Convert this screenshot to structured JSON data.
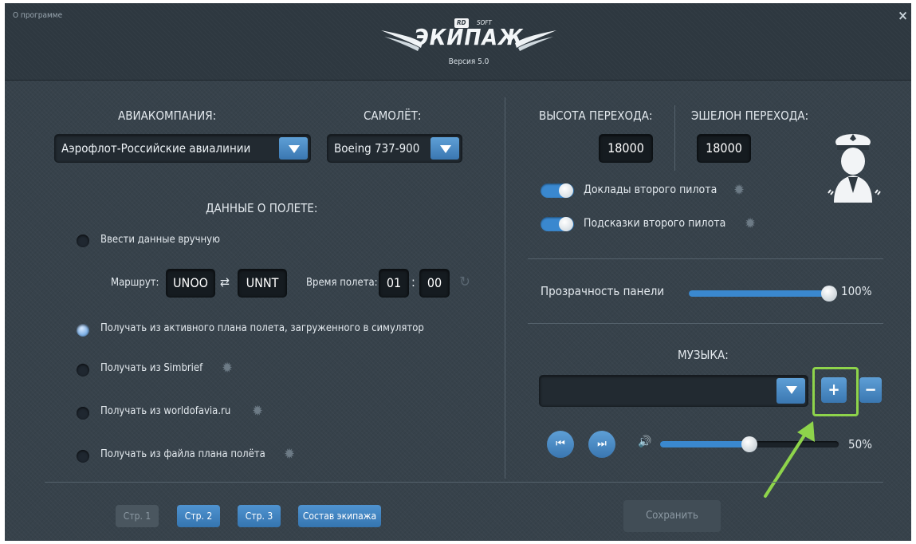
{
  "header": {
    "about_label": "О программе",
    "close_label": "×",
    "logo_badge": "RD",
    "logo_soft": "SOFT",
    "logo_title": "ЭКИПАЖ",
    "version": "Версия 5.0"
  },
  "left": {
    "airline_label": "АВИАКОМПАНИЯ:",
    "airline_value": "Аэрофлот-Российские авиалинии",
    "aircraft_label": "САМОЛЁТ:",
    "aircraft_value": "Boeing 737-900",
    "flight_data_label": "ДАННЫЕ О ПОЛЕТЕ:",
    "manual_option": "Ввести данные вручную",
    "route_label": "Маршрут:",
    "route_from": "UNOO",
    "swap_icon": "⇄",
    "route_to": "UNNT",
    "flight_time_label": "Время полета:",
    "hours": "01",
    "time_sep": ":",
    "minutes": "00",
    "options": [
      {
        "label": "Получать из активного плана полета, загруженного в симулятор",
        "selected": true
      },
      {
        "label": "Получать из Simbrief",
        "selected": false
      },
      {
        "label": "Получать из worldofavia.ru",
        "selected": false
      },
      {
        "label": "Получать из файла плана полёта",
        "selected": false
      }
    ]
  },
  "right": {
    "transition_alt_label": "ВЫСОТА ПЕРЕХОДА:",
    "transition_alt_value": "18000",
    "transition_level_label": "ЭШЕЛОН ПЕРЕХОДА:",
    "transition_level_value": "18000",
    "copilot_reports": {
      "label": "Доклады второго пилота",
      "on": true
    },
    "copilot_hints": {
      "label": "Подсказки второго пилота",
      "on": true
    },
    "panel_opacity_label": "Прозрачность панели",
    "panel_opacity_value": "100%",
    "panel_opacity": 1.0,
    "music_label": "МУЗЫКА:",
    "music_track": "",
    "add_label": "+",
    "remove_label": "−",
    "prev_label": "⏮",
    "next_label": "⏭",
    "volume_value": "50%",
    "volume": 0.5
  },
  "footer": {
    "page1": "Стр. 1",
    "page2": "Стр. 2",
    "page3": "Стр. 3",
    "crew": "Состав экипажа",
    "save": "Сохранить"
  },
  "colors": {
    "accent": "#3a88cf",
    "highlight": "#8ed44b",
    "arrow": "#8ed44b"
  }
}
